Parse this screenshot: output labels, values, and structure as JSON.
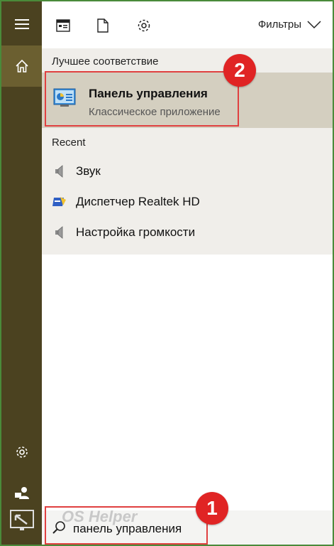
{
  "filters_label": "Фильтры",
  "sections": {
    "best_match": "Лучшее соответствие",
    "recent": "Recent"
  },
  "best_match": {
    "title": "Панель управления",
    "subtitle": "Классическое приложение"
  },
  "recent_items": [
    {
      "label": "Звук",
      "icon": "speaker-icon"
    },
    {
      "label": "Диспетчер Realtek HD",
      "icon": "realtek-icon"
    },
    {
      "label": "Настройка громкости",
      "icon": "speaker-icon"
    }
  ],
  "search": {
    "value": "панель управления"
  },
  "watermark": "OS Helper",
  "annotations": {
    "step1": "1",
    "step2": "2"
  },
  "colors": {
    "rail": "#4b4220",
    "rail_active": "#6b5f30",
    "highlight": "#d4cfc0",
    "annotation": "#e02424"
  }
}
